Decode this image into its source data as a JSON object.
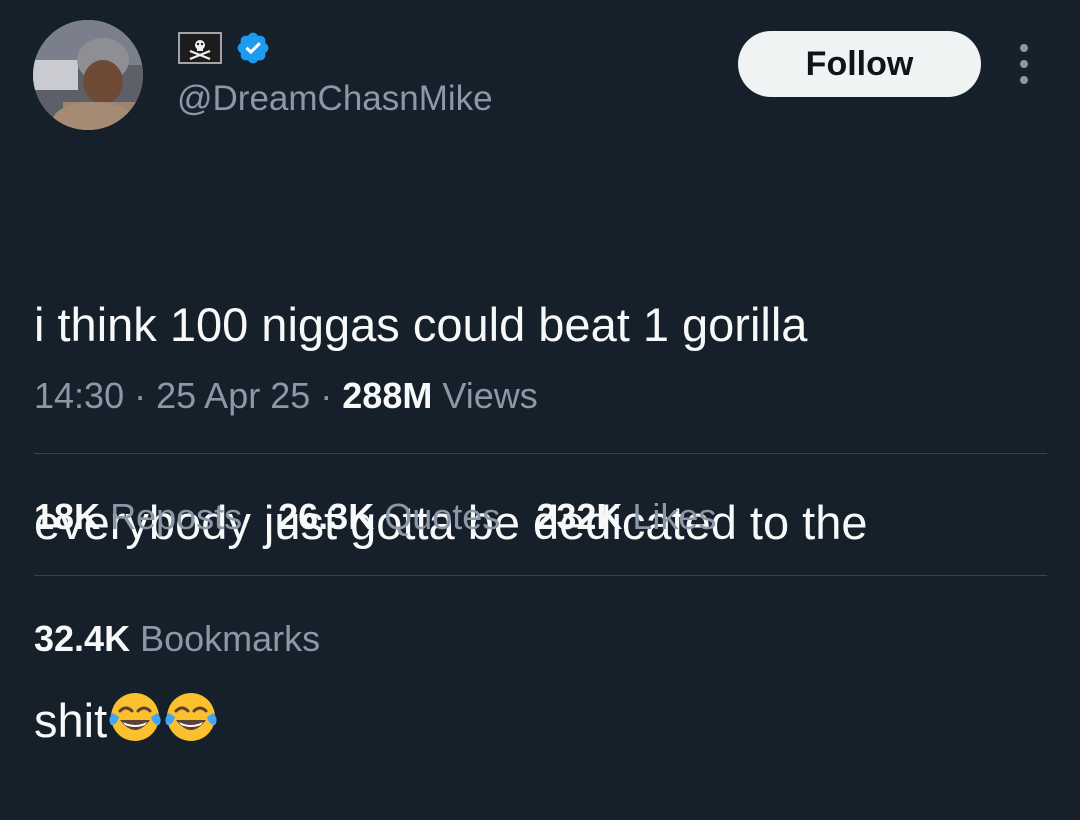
{
  "author": {
    "handle": "@DreamChasnMike",
    "flag_icon": "pirate-flag-icon",
    "verified_icon": "verified-badge-icon",
    "verified_color": "#1d9bf0"
  },
  "follow_label": "Follow",
  "tweet": {
    "line1": "i think 100 niggas could beat 1 gorilla",
    "line2": "everybody just gotta be dedicated to the",
    "line3": "shit",
    "emoji": "face-with-tears-of-joy-icon"
  },
  "meta": {
    "time": "14:30",
    "separator": "·",
    "date": "25 Apr 25",
    "views_count": "288M",
    "views_label": "Views"
  },
  "stats": {
    "reposts_count": "18K",
    "reposts_label": "Reposts",
    "quotes_count": "26.3K",
    "quotes_label": "Quotes",
    "likes_count": "232K",
    "likes_label": "Likes",
    "bookmarks_count": "32.4K",
    "bookmarks_label": "Bookmarks"
  },
  "colors": {
    "background": "#15202b",
    "text_primary": "#f7f9f9",
    "text_secondary": "#8b98a5",
    "divider": "#38444d",
    "follow_bg": "#eff3f4"
  }
}
